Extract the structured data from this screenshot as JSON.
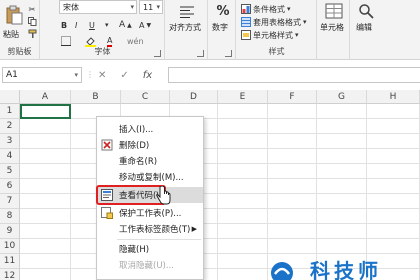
{
  "ribbon": {
    "paste_label": "粘贴",
    "clipboard_label": "剪贴板",
    "font_name": "宋体",
    "font_size": "11",
    "font_group_label": "字体",
    "bold": "B",
    "italic": "I",
    "underline": "U",
    "alignment_label": "对齐方式",
    "number_label": "数字",
    "percent": "%",
    "conditional_format": "条件格式",
    "table_format": "套用表格格式",
    "cell_style": "单元格样式",
    "styles_group_label": "样式",
    "cells_label": "单元格",
    "editing_label": "编辑"
  },
  "formula_bar": {
    "name_box": "A1",
    "cancel": "✕",
    "confirm": "✓",
    "fx": "fx",
    "value": ""
  },
  "columns": [
    "A",
    "B",
    "C",
    "D",
    "E",
    "F",
    "G",
    "H"
  ],
  "rows": [
    "1",
    "2",
    "3",
    "4",
    "5",
    "6",
    "7",
    "8",
    "9",
    "10",
    "11",
    "12"
  ],
  "context_menu": {
    "items": [
      {
        "label": "插入(I)...",
        "state": "normal"
      },
      {
        "label": "删除(D)",
        "state": "normal"
      },
      {
        "label": "重命名(R)",
        "state": "normal"
      },
      {
        "label": "移动或复制(M)...",
        "state": "normal"
      },
      {
        "label": "查看代码(V)",
        "state": "active"
      },
      {
        "label": "保护工作表(P)...",
        "state": "normal"
      },
      {
        "label": "工作表标签颜色(T)",
        "state": "normal"
      },
      {
        "label": "隐藏(H)",
        "state": "normal"
      },
      {
        "label": "取消隐藏(U)...",
        "state": "disabled"
      }
    ]
  },
  "colors": {
    "accent_green": "#217346",
    "highlight_red": "#e02020",
    "watermark_blue": "#1a73c8"
  },
  "watermark": {
    "text": "科技师"
  }
}
